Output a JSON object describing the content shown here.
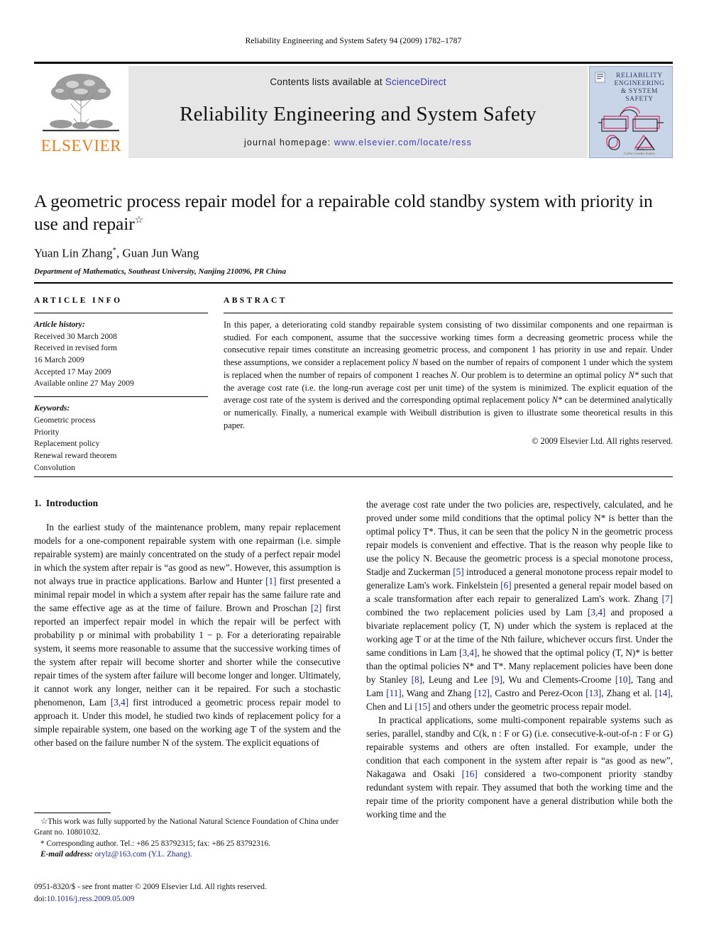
{
  "running_head": "Reliability Engineering and System Safety 94 (2009) 1782–1787",
  "masthead": {
    "publisher_name": "ELSEVIER",
    "contents_prefix": "Contents lists available at ",
    "contents_link": "ScienceDirect",
    "journal_title": "Reliability Engineering and System Safety",
    "homepage_prefix": "journal homepage: ",
    "homepage_url": "www.elsevier.com/locate/ress",
    "cover": {
      "line1": "RELIABILITY",
      "line2": "ENGINEERING",
      "line3": "& SYSTEM",
      "line4": "SAFETY",
      "credit_line1": "Edited by",
      "credit_line2": "Carlos Guedes Soares",
      "background_color": "#c8d4e8",
      "accent_color": "#e0275b"
    },
    "band_color": "#e6e6e6",
    "elsevier_color": "#E87B1E",
    "link_color": "#3b3bb0"
  },
  "article": {
    "title": "A geometric process repair model for a repairable cold standby system with priority in use and repair",
    "title_marker": "☆",
    "authors": "Yuan Lin Zhang",
    "author_marker": "*",
    "authors_rest": ", Guan Jun Wang",
    "affiliation": "Department of Mathematics, Southeast University, Nanjing 210096, PR China"
  },
  "article_info": {
    "heading": "ARTICLE INFO",
    "history_label": "Article history:",
    "history": [
      "Received 30 March 2008",
      "Received in revised form",
      "16 March 2009",
      "Accepted 17 May 2009",
      "Available online 27 May 2009"
    ],
    "keywords_label": "Keywords:",
    "keywords": [
      "Geometric process",
      "Priority",
      "Replacement policy",
      "Renewal reward theorem",
      "Convolution"
    ]
  },
  "abstract": {
    "heading": "ABSTRACT",
    "text_part1": "In this paper, a deteriorating cold standby repairable system consisting of two dissimilar components and one repairman is studied. For each component, assume that the successive working times form a decreasing geometric process while the consecutive repair times constitute an increasing geometric process, and component 1 has priority in use and repair. Under these assumptions, we consider a replacement policy ",
    "policy_symbol_1": "N",
    "text_part2": " based on the number of repairs of component 1 under which the system is replaced when the number of repairs of component 1 reaches ",
    "policy_symbol_2": "N",
    "text_part3": ". Our problem is to determine an optimal policy ",
    "policy_symbol_3": "N*",
    "text_part4": " such that the average cost rate (i.e. the long-run average cost per unit time) of the system is minimized. The explicit equation of the average cost rate of the system is derived and the corresponding optimal replacement policy ",
    "policy_symbol_4": "N*",
    "text_part5": " can be determined analytically or numerically. Finally, a numerical example with Weibull distribution is given to illustrate some theoretical results in this paper.",
    "copyright": "© 2009 Elsevier Ltd. All rights reserved."
  },
  "body": {
    "section_number": "1.",
    "section_title": "Introduction",
    "left_paragraph": "In the earliest study of the maintenance problem, many repair replacement models for a one-component repairable system with one repairman (i.e. simple repairable system) are mainly concentrated on the study of a perfect repair model in which the system after repair is “as good as new”. However, this assumption is not always true in practice applications. Barlow and Hunter [1] first presented a minimal repair model in which a system after repair has the same failure rate and the same effective age as at the time of failure. Brown and Proschan [2] first reported an imperfect repair model in which the repair will be perfect with probability p or minimal with probability 1 − p. For a deteriorating repairable system, it seems more reasonable to assume that the successive working times of the system after repair will become shorter and shorter while the consecutive repair times of the system after failure will become longer and longer. Ultimately, it cannot work any longer, neither can it be repaired. For such a stochastic phenomenon, Lam [3,4] first introduced a geometric process repair model to approach it. Under this model, he studied two kinds of replacement policy for a simple repairable system, one based on the working age T of the system and the other based on the failure number N of the system. The explicit equations of",
    "right_paragraph_1": "the average cost rate under the two policies are, respectively, calculated, and he proved under some mild conditions that the optimal policy N* is better than the optimal policy T*. Thus, it can be seen that the policy N in the geometric process repair models is convenient and effective. That is the reason why people like to use the policy N. Because the geometric process is a special monotone process, Stadje and Zuckerman [5] introduced a general monotone process repair model to generalize Lam's work. Finkelstein [6] presented a general repair model based on a scale transformation after each repair to generalized Lam's work. Zhang [7] combined the two replacement policies used by Lam [3,4] and proposed a bivariate replacement policy (T, N) under which the system is replaced at the working age T or at the time of the Nth failure, whichever occurs first. Under the same conditions in Lam [3,4], he showed that the optimal policy (T, N)* is better than the optimal policies N* and T*. Many replacement policies have been done by Stanley [8], Leung and Lee [9], Wu and Clements-Croome [10], Tang and Lam [11], Wang and Zhang [12], Castro and Perez-Ocon [13], Zhang et al. [14], Chen and Li [15] and others under the geometric process repair model.",
    "right_paragraph_2": "In practical applications, some multi-component repairable systems such as series, parallel, standby and C(k, n : F or G) (i.e. consecutive-k-out-of-n : F or G) repairable systems and others are often installed. For example, under the condition that each component in the system after repair is “as good as new”, Nakagawa and Osaki [16] considered a two-component priority standby redundant system with repair. They assumed that both the working time and the repair time of the priority component have a general distribution while both the working time and the"
  },
  "footnotes": {
    "funding_marker": "☆",
    "funding": "This work was fully supported by the National Natural Science Foundation of China under Grant no. 10801032.",
    "corresponding_marker": "*",
    "corresponding": "Corresponding author. Tel.: +86 25 83792315; fax: +86 25 83792316.",
    "email_label": "E-mail address:",
    "email": "orylz@163.com",
    "email_owner": "(Y.L. Zhang)."
  },
  "imprint": {
    "issn_line": "0951-8320/$ - see front matter © 2009 Elsevier Ltd. All rights reserved.",
    "doi_label": "doi:",
    "doi": "10.1016/j.ress.2009.05.009"
  }
}
